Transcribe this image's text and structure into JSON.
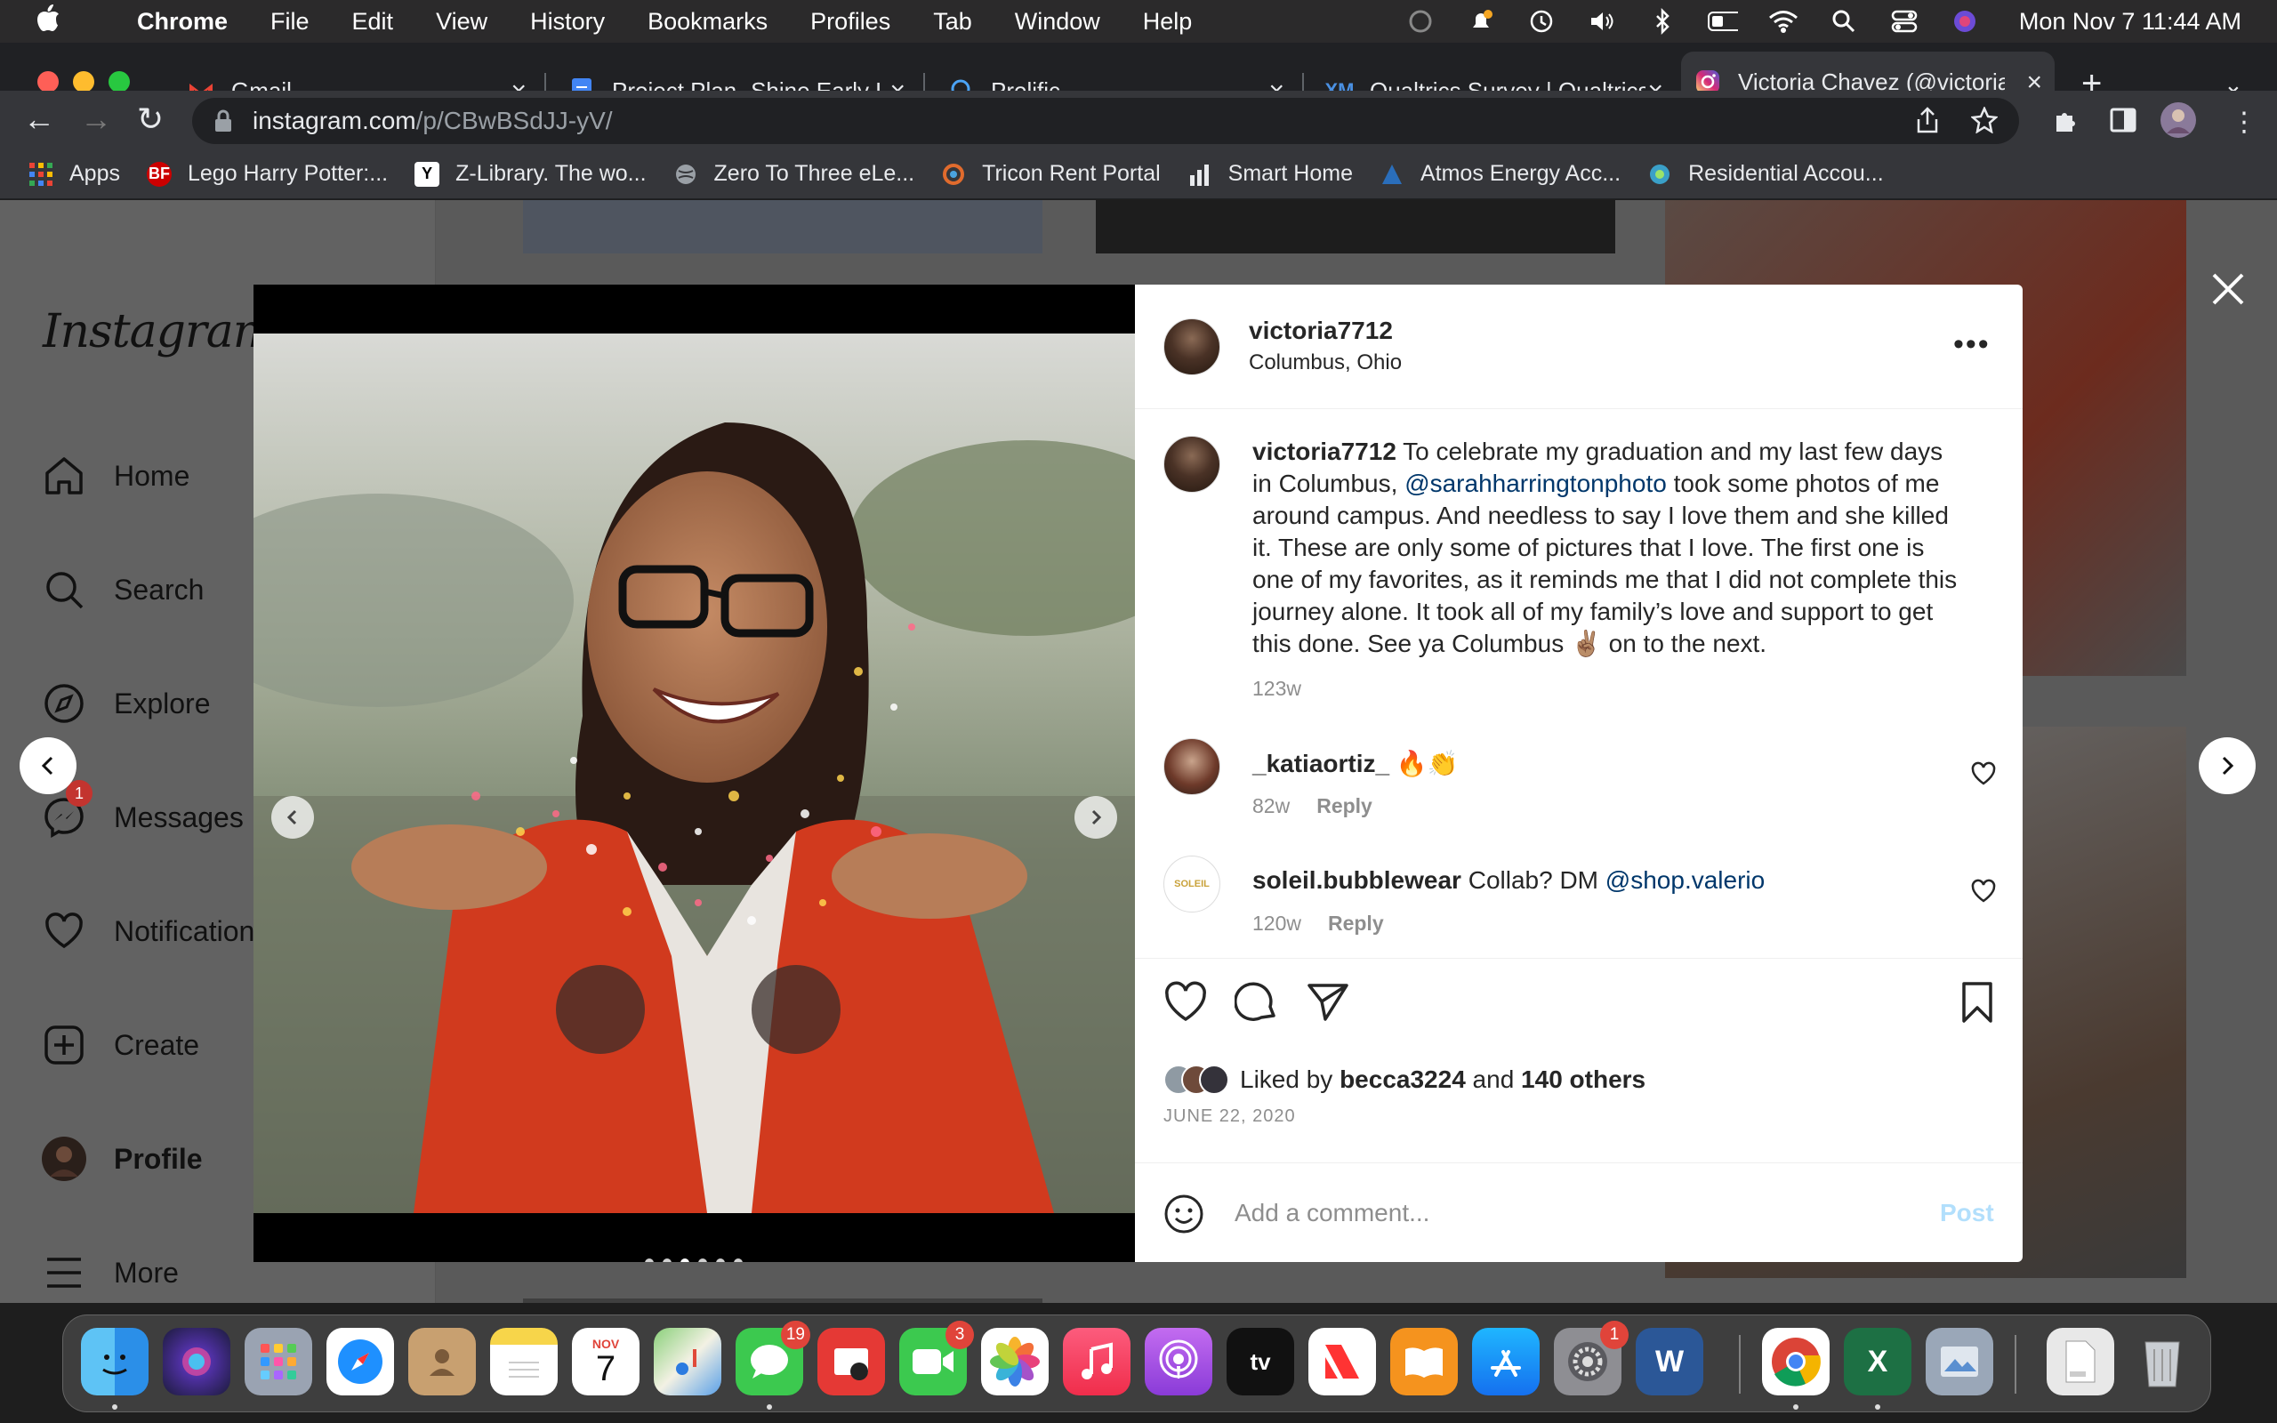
{
  "menubar": {
    "app": "Chrome",
    "items": [
      "File",
      "Edit",
      "View",
      "History",
      "Bookmarks",
      "Profiles",
      "Tab",
      "Window",
      "Help"
    ],
    "clock": "Mon Nov 7  11:44 AM"
  },
  "tabs": [
    {
      "title": "Gmail"
    },
    {
      "title": "Project Plan- Shine Early L"
    },
    {
      "title": "Prolific"
    },
    {
      "title": "Qualtrics Survey | Qualtrics"
    },
    {
      "title": "Victoria Chavez (@victoria"
    }
  ],
  "address": {
    "host": "instagram.com",
    "path": "/p/CBwBSdJJ-yV/"
  },
  "bookmarks": [
    {
      "label": "Apps"
    },
    {
      "label": "Lego Harry Potter:..."
    },
    {
      "label": "Z-Library. The wo..."
    },
    {
      "label": "Zero To Three eLe..."
    },
    {
      "label": "Tricon Rent Portal"
    },
    {
      "label": "Smart Home"
    },
    {
      "label": "Atmos Energy Acc..."
    },
    {
      "label": "Residential Accou..."
    }
  ],
  "instagram": {
    "logo": "Instagram",
    "nav": [
      {
        "label": "Home"
      },
      {
        "label": "Search"
      },
      {
        "label": "Explore"
      },
      {
        "label": "Messages",
        "badge": "1"
      },
      {
        "label": "Notifications"
      },
      {
        "label": "Create"
      },
      {
        "label": "Profile"
      },
      {
        "label": "More"
      }
    ]
  },
  "post": {
    "username": "victoria7712",
    "location": "Columbus, Ohio",
    "caption_user": "victoria7712",
    "caption_part1": " To celebrate my graduation and my last few days in Columbus, ",
    "caption_mention": "@sarahharringtonphoto",
    "caption_part2": " took some photos of me around campus. And needless to say I love them and she killed it. These are only some of pictures that I love. The first one is one of my favorites, as it reminds me that I did not complete this journey alone. It took all of my family’s love and support to get this done. See ya Columbus ✌🏽 on to the next.",
    "caption_time": "123w",
    "comments": [
      {
        "user": "_katiaortiz_",
        "text": " 🔥👏",
        "mention": "",
        "time": "82w",
        "reply": "Reply"
      },
      {
        "user": "soleil.bubblewear",
        "text": " Collab? DM ",
        "mention": "@shop.valerio",
        "time": "120w",
        "reply": "Reply"
      }
    ],
    "likes_prefix": "Liked by ",
    "likes_user": "becca3224",
    "likes_and": " and ",
    "likes_others": "140 others",
    "date": "JUNE 22, 2020",
    "comment_placeholder": "Add a comment...",
    "post_button": "Post",
    "commenter2_avatar_text": "SOLEIL",
    "carousel": {
      "count": 6,
      "active": 2
    }
  },
  "dock": {
    "calendar_month": "NOV",
    "calendar_day": "7",
    "badges": {
      "messages": "19",
      "facetime": "3",
      "settings": "1"
    }
  }
}
